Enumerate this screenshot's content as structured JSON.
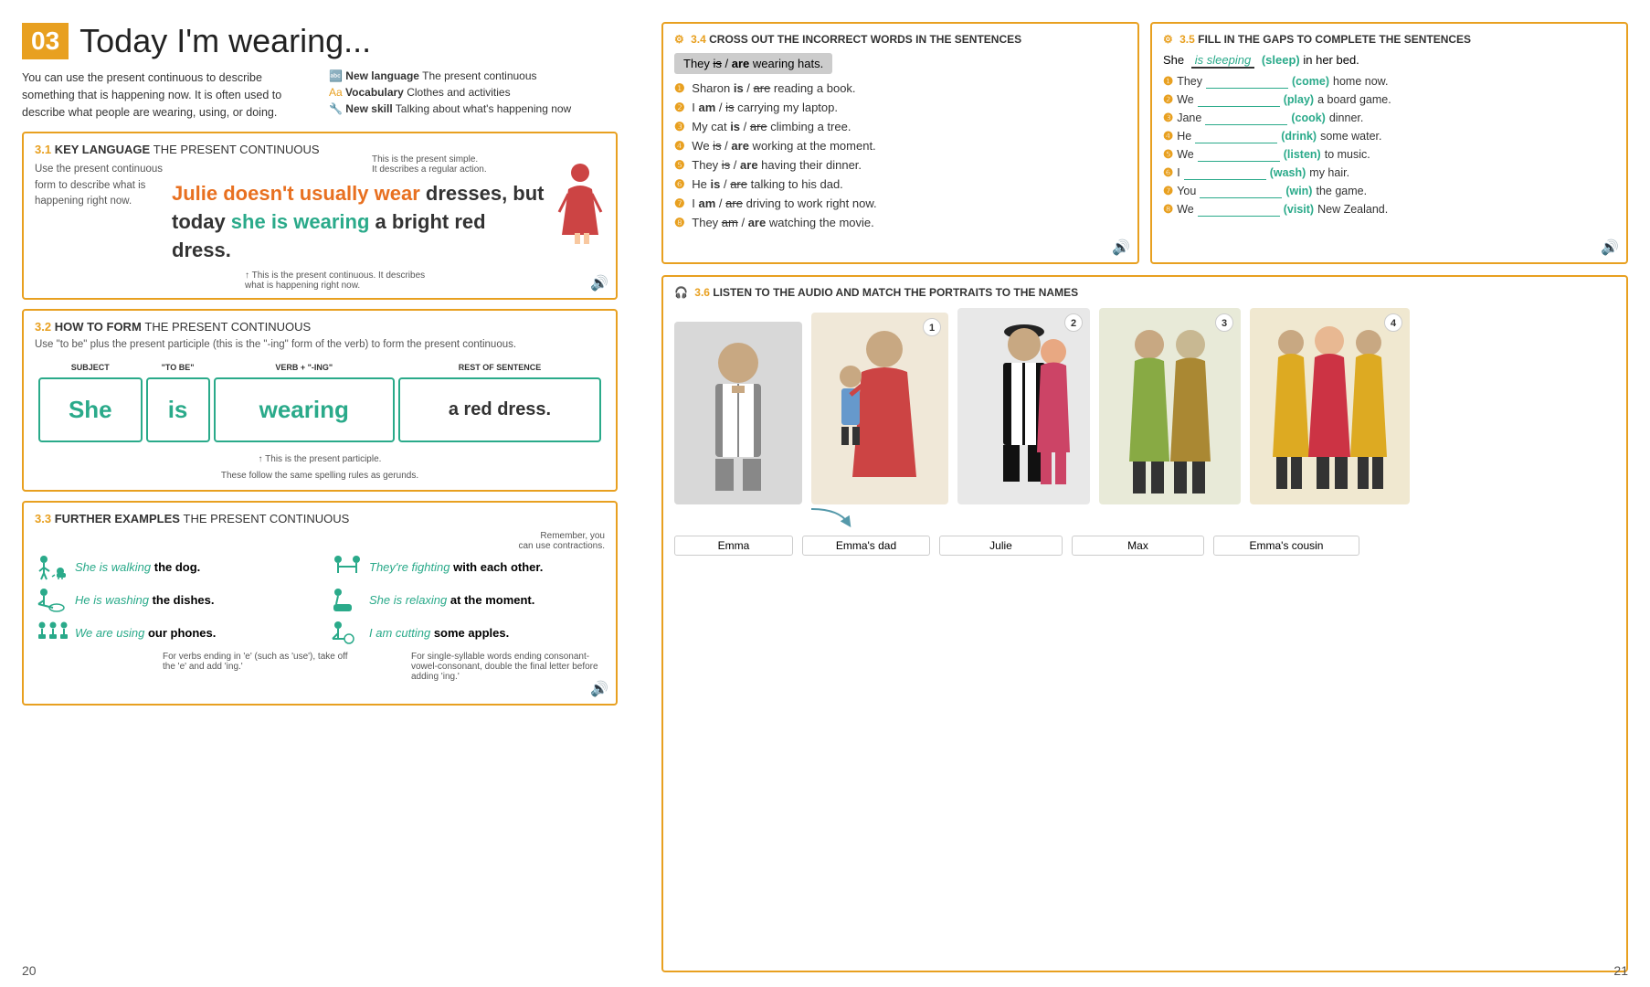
{
  "left_page": {
    "page_num": "20",
    "lesson_num": "03",
    "lesson_title": "Today I'm wearing...",
    "intro_left": "You can use the present continuous to describe something that is happening now. It is often used to describe what people are wearing, using, or doing.",
    "intro_right": {
      "new_language_label": "New language",
      "new_language_val": "The present continuous",
      "vocabulary_label": "Vocabulary",
      "vocabulary_val": "Clothes and activities",
      "new_skill_label": "New skill",
      "new_skill_val": "Talking about what's happening now"
    },
    "section31": {
      "num": "3.1",
      "label": "KEY LANGUAGE",
      "title": "THE PRESENT CONTINUOUS",
      "side_note": "Use the present continuous form to describe what is happening right now.",
      "top_note": "This is the present simple. It describes a regular action.",
      "sentence_part1": "Julie doesn't usually wear",
      "sentence_part2": "dresses, but",
      "sentence_part3": "today",
      "sentence_part4": "she is wearing",
      "sentence_part5": "a bright red dress.",
      "bottom_note": "This is the present continuous. It describes what is happening right now."
    },
    "section32": {
      "num": "3.2",
      "label": "HOW TO FORM",
      "title": "THE PRESENT CONTINUOUS",
      "description": "Use \"to be\" plus the present participle (this is the \"-ing\" form of the verb) to form the present continuous.",
      "headers": [
        "SUBJECT",
        "\"TO BE\"",
        "VERB + \"-ING\"",
        "REST OF SENTENCE"
      ],
      "cells": [
        "She",
        "is",
        "wearing",
        "a red dress."
      ],
      "bottom_note": "This is the present participle. These follow the same spelling rules as gerunds."
    },
    "section33": {
      "num": "3.3",
      "label": "FURTHER EXAMPLES",
      "title": "THE PRESENT CONTINUOUS",
      "examples": [
        {
          "text_teal": "She is walking",
          "text_bold": "the dog."
        },
        {
          "text_teal": "They're fighting",
          "text_bold": "with each other."
        },
        {
          "text_teal": "He is washing",
          "text_bold": "the dishes."
        },
        {
          "text_teal": "She is relaxing",
          "text_bold": "at the moment."
        },
        {
          "text_teal": "We are using",
          "text_bold": "our phones."
        },
        {
          "text_teal": "I am cutting",
          "text_bold": "some apples."
        }
      ],
      "note1": "For verbs ending in 'e' (such as 'use'), take off the 'e' and add 'ing.'",
      "note2": "For single-syllable words ending consonant-vowel-consonant, double the final letter before adding 'ing.'",
      "remember": "Remember, you can use contractions."
    }
  },
  "right_page": {
    "page_num": "21",
    "section34": {
      "num": "3.4",
      "label": "CROSS OUT THE INCORRECT WORDS IN THE SENTENCES",
      "intro": "They is̶/ are wearing hats.",
      "intro_crossout": "is",
      "intro_keep": "are",
      "items": [
        {
          "num": "1",
          "text": "Sharon is / are reading a book.",
          "correct": "is"
        },
        {
          "num": "2",
          "text": "I am / is carrying my laptop.",
          "correct": "am"
        },
        {
          "num": "3",
          "text": "My cat is / are climbing a tree.",
          "correct": "is"
        },
        {
          "num": "4",
          "text": "We is / are working at the moment.",
          "correct": "are"
        },
        {
          "num": "5",
          "text": "They is / are having their dinner.",
          "correct": "are"
        },
        {
          "num": "6",
          "text": "He is / are talking to his dad.",
          "correct": "is"
        },
        {
          "num": "7",
          "text": "I am / are driving to work right now.",
          "correct": "am"
        },
        {
          "num": "8",
          "text": "They am / are watching the movie.",
          "correct": "are"
        }
      ]
    },
    "section35": {
      "num": "3.5",
      "label": "FILL IN THE GAPS TO COMPLETE THE SENTENCES",
      "intro_text": "She",
      "intro_blank": "is sleeping",
      "intro_hint": "(sleep)",
      "intro_end": "in her bed.",
      "items": [
        {
          "num": "1",
          "start": "They",
          "blank": "",
          "hint": "(come)",
          "end": "home now."
        },
        {
          "num": "2",
          "start": "We",
          "blank": "",
          "hint": "(play)",
          "end": "a board game."
        },
        {
          "num": "3",
          "start": "Jane",
          "blank": "",
          "hint": "(cook)",
          "end": "dinner."
        },
        {
          "num": "4",
          "start": "He",
          "blank": "",
          "hint": "(drink)",
          "end": "some water."
        },
        {
          "num": "5",
          "start": "We",
          "blank": "",
          "hint": "(listen)",
          "end": "to music."
        },
        {
          "num": "6",
          "start": "I",
          "blank": "",
          "hint": "(wash)",
          "end": "my hair."
        },
        {
          "num": "7",
          "start": "You",
          "blank": "",
          "hint": "(win)",
          "end": "the game."
        },
        {
          "num": "8",
          "start": "We",
          "blank": "",
          "hint": "(visit)",
          "end": "New Zealand."
        }
      ]
    },
    "section36": {
      "num": "3.6",
      "label": "LISTEN TO THE AUDIO AND MATCH THE PORTRAITS TO THE NAMES",
      "names": [
        "Emma",
        "Emma's dad",
        "Julie",
        "Max",
        "Emma's cousin"
      ],
      "portrait_nums": [
        "",
        "1",
        "",
        "2",
        "3",
        "4"
      ]
    }
  }
}
